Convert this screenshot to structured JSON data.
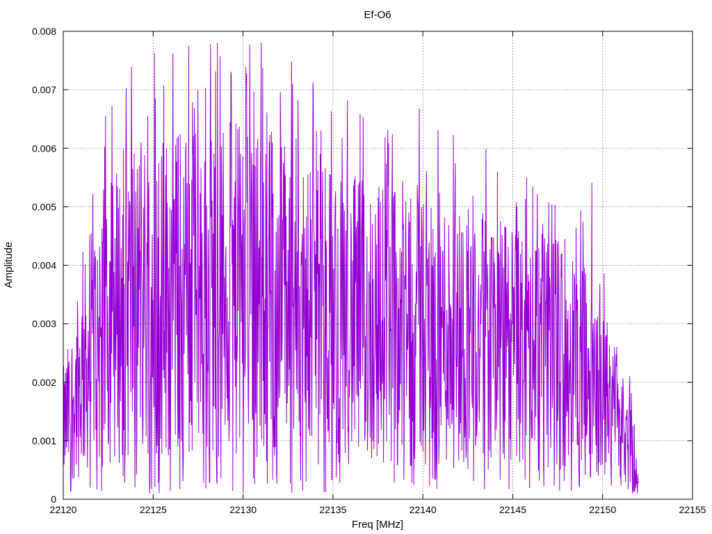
{
  "chart_data": {
    "type": "line",
    "title": "Ef-O6",
    "xlabel": "Freq [MHz]",
    "ylabel": "Amplitude",
    "xlim": [
      22120,
      22155
    ],
    "ylim": [
      0,
      0.008
    ],
    "x_ticks": [
      "22120",
      "22125",
      "22130",
      "22135",
      "22140",
      "22145",
      "22150",
      "22155"
    ],
    "y_ticks": [
      "0",
      "0.001",
      "0.002",
      "0.003",
      "0.004",
      "0.005",
      "0.006",
      "0.007",
      "0.008"
    ],
    "grid": true,
    "legend": "none",
    "series": [
      {
        "color": "#9400d3",
        "x_start": 22120,
        "x_end": 22152,
        "peaks": [
          {
            "x": 22123.5,
            "y": 0.00703
          },
          {
            "x": 22124.7,
            "y": 0.00655
          },
          {
            "x": 22130.2,
            "y": 0.00727
          },
          {
            "x": 22132.7,
            "y": 0.00748
          },
          {
            "x": 22133.9,
            "y": 0.00702
          },
          {
            "x": 22139.8,
            "y": 0.00668
          },
          {
            "x": 22149.4,
            "y": 0.00541
          },
          {
            "x": 22151.9,
            "y": 0.00028
          }
        ],
        "envelope": [
          {
            "x": 22120,
            "y": 0.0015
          },
          {
            "x": 22121,
            "y": 0.0025
          },
          {
            "x": 22122,
            "y": 0.0035
          },
          {
            "x": 22124,
            "y": 0.0042
          },
          {
            "x": 22128,
            "y": 0.0043
          },
          {
            "x": 22132,
            "y": 0.0043
          },
          {
            "x": 22136,
            "y": 0.0037
          },
          {
            "x": 22140,
            "y": 0.0036
          },
          {
            "x": 22144,
            "y": 0.0032
          },
          {
            "x": 22148,
            "y": 0.003
          },
          {
            "x": 22150,
            "y": 0.0022
          },
          {
            "x": 22151.5,
            "y": 0.0012
          },
          {
            "x": 22152,
            "y": 0.0003
          }
        ]
      }
    ]
  }
}
